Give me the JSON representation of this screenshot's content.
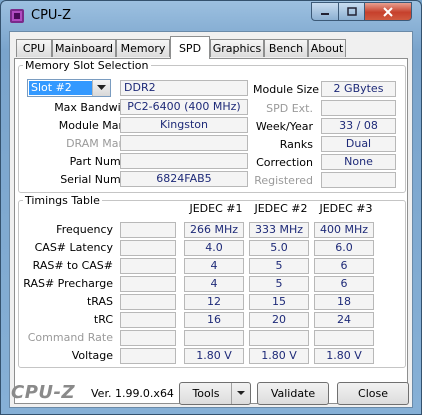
{
  "window": {
    "title": "CPU-Z"
  },
  "tabs": [
    {
      "label": "CPU"
    },
    {
      "label": "Mainboard"
    },
    {
      "label": "Memory"
    },
    {
      "label": "SPD"
    },
    {
      "label": "Graphics"
    },
    {
      "label": "Bench"
    },
    {
      "label": "About"
    }
  ],
  "active_tab": "SPD",
  "memory_slot": {
    "legend": "Memory Slot Selection",
    "slot_selected": "Slot #2",
    "memory_type": "DDR2",
    "max_bandwidth_label": "Max Bandwidth",
    "max_bandwidth": "PC2-6400 (400 MHz)",
    "module_manuf_label": "Module Manuf.",
    "module_manuf": "Kingston",
    "dram_manuf_label": "DRAM Manuf.",
    "dram_manuf": "",
    "part_number_label": "Part Number",
    "part_number": "",
    "serial_number_label": "Serial Number",
    "serial_number": "6824FAB5",
    "module_size_label": "Module Size",
    "module_size": "2 GBytes",
    "spd_ext_label": "SPD Ext.",
    "spd_ext": "",
    "week_year_label": "Week/Year",
    "week_year": "33 / 08",
    "ranks_label": "Ranks",
    "ranks": "Dual",
    "correction_label": "Correction",
    "correction": "None",
    "registered_label": "Registered",
    "registered": ""
  },
  "timings": {
    "legend": "Timings Table",
    "columns": [
      "JEDEC #1",
      "JEDEC #2",
      "JEDEC #3"
    ],
    "rows": [
      {
        "label": "Frequency",
        "values": [
          "266 MHz",
          "333 MHz",
          "400 MHz"
        ],
        "dim": false
      },
      {
        "label": "CAS# Latency",
        "values": [
          "4.0",
          "5.0",
          "6.0"
        ],
        "dim": false
      },
      {
        "label": "RAS# to CAS#",
        "values": [
          "4",
          "5",
          "6"
        ],
        "dim": false
      },
      {
        "label": "RAS# Precharge",
        "values": [
          "4",
          "5",
          "6"
        ],
        "dim": false
      },
      {
        "label": "tRAS",
        "values": [
          "12",
          "15",
          "18"
        ],
        "dim": false
      },
      {
        "label": "tRC",
        "values": [
          "16",
          "20",
          "24"
        ],
        "dim": false
      },
      {
        "label": "Command Rate",
        "values": [
          "",
          "",
          ""
        ],
        "dim": true
      },
      {
        "label": "Voltage",
        "values": [
          "1.80 V",
          "1.80 V",
          "1.80 V"
        ],
        "dim": false
      }
    ]
  },
  "footer": {
    "logo": "CPU-Z",
    "version": "Ver. 1.99.0.x64",
    "tools_label": "Tools",
    "validate_label": "Validate",
    "close_label": "Close"
  },
  "colors": {
    "value_text": "#1e2a78",
    "selection": "#3399ff",
    "close_button": "#c6402c"
  }
}
